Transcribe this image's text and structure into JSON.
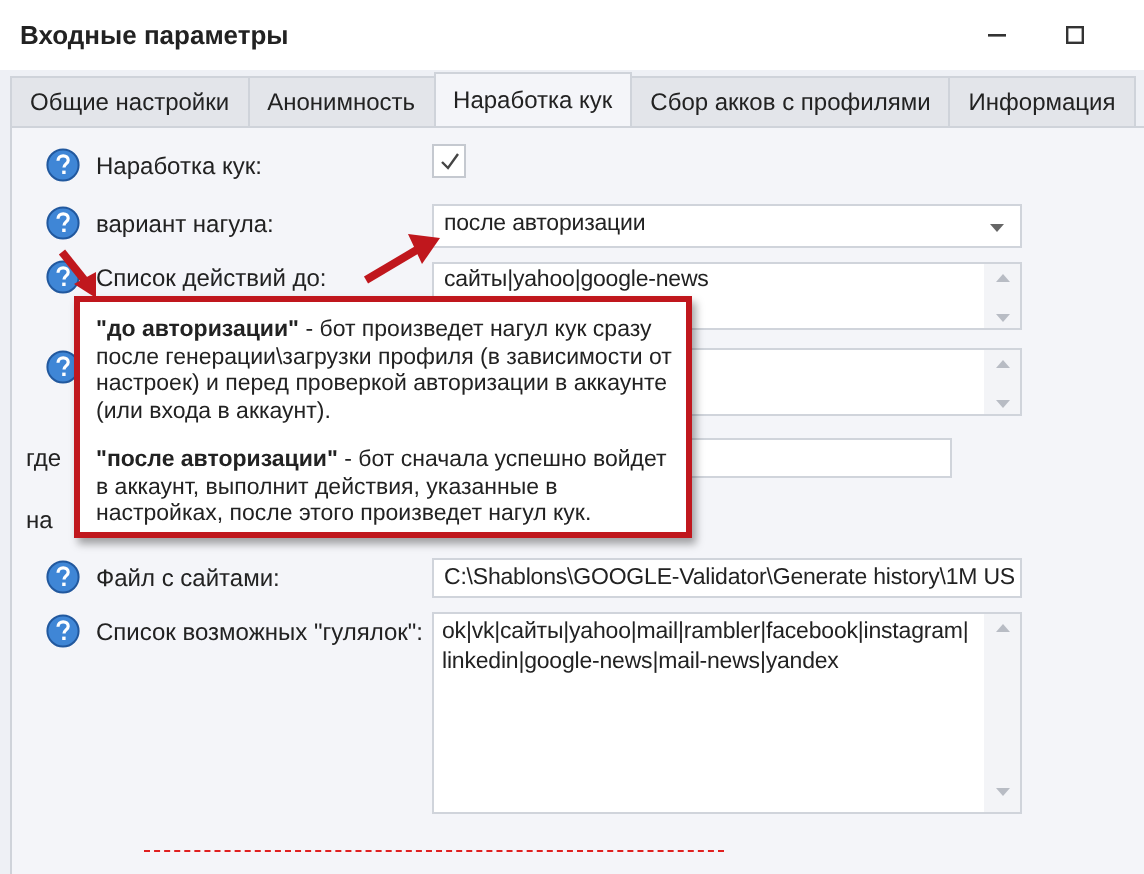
{
  "window": {
    "title": "Входные параметры"
  },
  "tabs": [
    {
      "label": "Общие настройки",
      "selected": false
    },
    {
      "label": "Анонимность",
      "selected": false
    },
    {
      "label": "Наработка кук",
      "selected": true
    },
    {
      "label": "Сбор акков с профилями",
      "selected": false
    },
    {
      "label": "Информация",
      "selected": false
    }
  ],
  "rows": [
    {
      "kind": "checkbox",
      "help": true,
      "label": "Наработка кук:",
      "checked": true
    },
    {
      "kind": "dropdown",
      "help": true,
      "label": "вариант нагула:",
      "value": "после авторизации"
    },
    {
      "kind": "textarea",
      "help": true,
      "label": "Список действий до:",
      "value": "сайты|yahoo|google-news"
    },
    {
      "kind": "textarea",
      "help": true
    },
    {
      "kind": "text",
      "help": false,
      "label": "где"
    },
    {
      "kind": "plain",
      "help": false,
      "label": "на"
    },
    {
      "kind": "file",
      "help": true,
      "label": "Файл с сайтами:",
      "value": "C:\\Shablons\\GOOGLE-Validator\\Generate history\\1M US"
    },
    {
      "kind": "bigtext",
      "help": true,
      "label": "Список возможных \"гулялок\":",
      "value": "ok|vk|сайты|yahoo|mail|rambler|facebook|instagram|linkedin|google-news|mail-news|yandex"
    }
  ],
  "callout": {
    "paragraphs": [
      "**\"до авторизации\"** - бот произведет нагул кук сразу после генерации\\загрузки профиля (в зависимости от настроек) и перед проверкой авторизации в аккаунте (или входа в аккаунт).",
      "**\"после авторизации\"** - бот сначала успешно войдет в аккаунт, выполнит действия, указанные в настройках, после этого произведет нагул кук."
    ]
  }
}
